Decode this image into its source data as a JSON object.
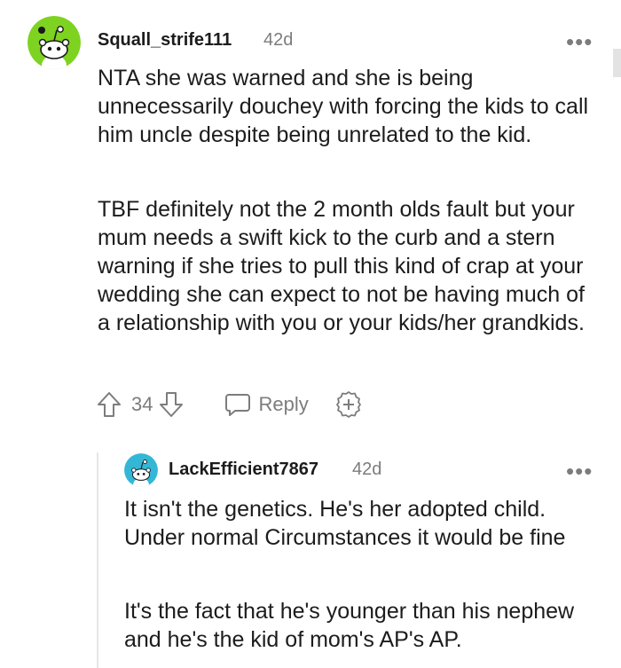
{
  "comment": {
    "username": "Squall_strife111",
    "age": "42d",
    "more": "•••",
    "avatar_icon": "reddit-snoo-icon",
    "avatar_color": "#7ed321",
    "paragraphs": [
      "NTA she was warned and she is being unnecessarily douchey with forcing the kids to call him uncle despite being unrelated to the kid.",
      "TBF definitely not the 2 month olds fault but your mum needs a swift kick to the curb and a stern warning if she tries to pull this kind of crap at your wedding she can expect to not be having much of a relationship with you or your kids/her grandkids."
    ],
    "votes": "34",
    "reply_label": "Reply"
  },
  "reply": {
    "username": "LackEfficient7867",
    "age": "42d",
    "more": "•••",
    "avatar_icon": "reddit-snoo-icon",
    "avatar_color": "#34b7d6",
    "paragraphs": [
      "It isn't the genetics. He's her adopted child. Under normal Circumstances it would be fine",
      "It's the fact that he's younger than his nephew and he's the kid of mom's AP's AP."
    ]
  }
}
